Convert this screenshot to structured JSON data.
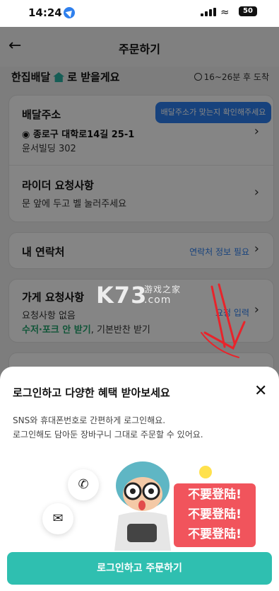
{
  "status": {
    "time": "14:24",
    "battery": "50"
  },
  "nav": {
    "title": "주문하기"
  },
  "delivery": {
    "prefix": "한집배달",
    "suffix": "로 받을게요",
    "eta": "16~26분 후 도착"
  },
  "address": {
    "heading": "배달주소",
    "line1": "종로구 대학로14길 25-1",
    "line2": "윤서빌딩 302",
    "tooltip": "배달주소가 맞는지 확인해주세요"
  },
  "rider": {
    "heading": "라이더 요청사항",
    "note": "문 앞에 두고 벨 눌러주세요"
  },
  "contact": {
    "heading": "내 연락처",
    "link": "연락처 정보 필요"
  },
  "store": {
    "heading": "가게 요청사항",
    "note": "요청사항 없음",
    "option_green": "수저·포크 안 받기",
    "option_rest": ", 기본반찬 받기",
    "link": "요청 입력"
  },
  "watermark": {
    "brand": "K73",
    "cn": "游戏之家",
    "domain": ".com"
  },
  "sheet": {
    "title": "로그인하고 다양한 혜택 받아보세요",
    "line1": "SNS와 휴대폰번호로 간편하게 로그인해요.",
    "line2": "로그인해도 담아둔 장바구니 그대로 주문할 수 있어요.",
    "stamp": [
      "不要登陆!",
      "不要登陆!",
      "不要登陆!"
    ],
    "cta": "로그인하고 주문하기"
  },
  "icons": {
    "back": "arrow-left-icon",
    "close": "close-icon",
    "phone": "phone-icon",
    "mail": "mail-icon",
    "pin": "location-pin-icon",
    "clock": "clock-icon"
  },
  "colors": {
    "accent": "#2fbfb0",
    "link": "#2d7ff0",
    "stamp": "#f1545c",
    "annotation": "#e8242b"
  }
}
